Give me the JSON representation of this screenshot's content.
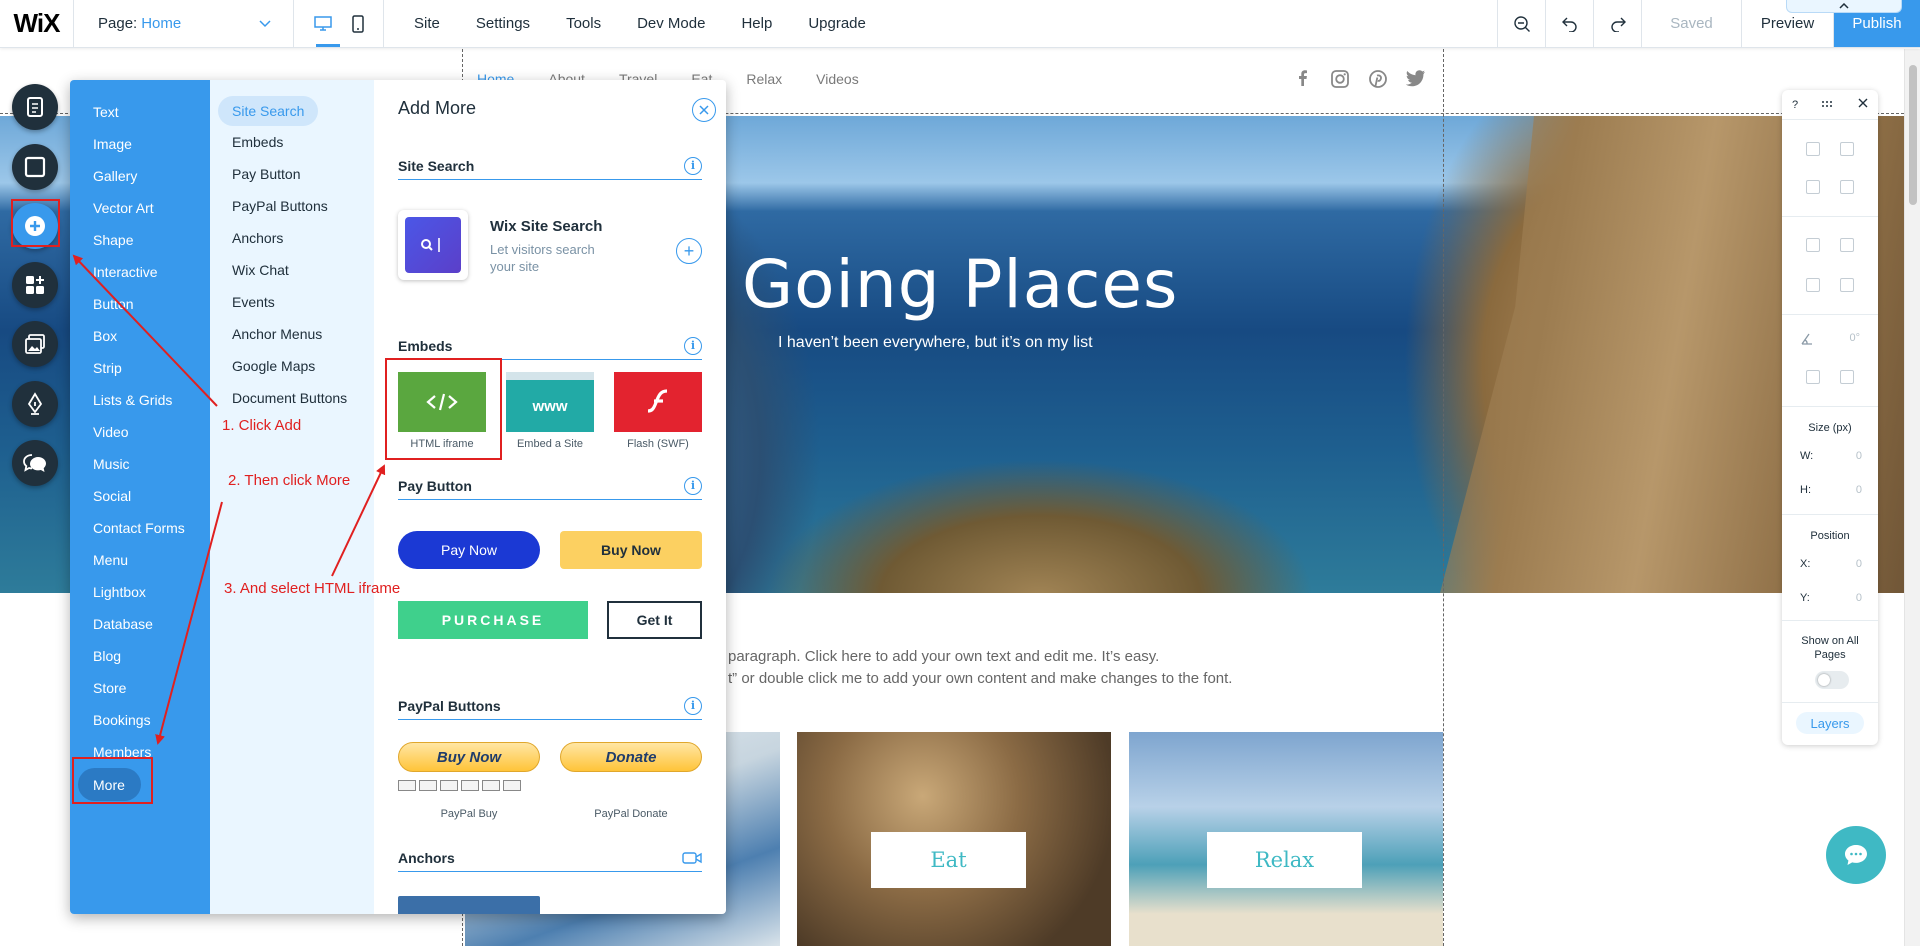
{
  "topbar": {
    "logo": "WiX",
    "page_label": "Page:",
    "page_value": "Home",
    "menu": [
      "Site",
      "Settings",
      "Tools",
      "Dev Mode",
      "Help",
      "Upgrade"
    ],
    "saved": "Saved",
    "preview": "Preview",
    "publish": "Publish",
    "accent_color": "#3899ec"
  },
  "site": {
    "nav": [
      "Home",
      "About",
      "Travel",
      "Eat",
      "Relax",
      "Videos"
    ],
    "social": [
      "facebook-icon",
      "instagram-icon",
      "pinterest-icon",
      "twitter-icon"
    ],
    "hero_title": "Going Places",
    "hero_subtitle": "I haven’t been everywhere, but it’s on my list",
    "para_line1": "paragraph. Click here to add your own text and edit me. It’s easy.",
    "para_line2": "t” or double click me to add your own content and make changes to the font.",
    "tiles": [
      "Eat",
      "Relax"
    ]
  },
  "add_panel": {
    "main_items": [
      "Text",
      "Image",
      "Gallery",
      "Vector Art",
      "Shape",
      "Interactive",
      "Button",
      "Box",
      "Strip",
      "Lists & Grids",
      "Video",
      "Music",
      "Social",
      "Contact Forms",
      "Menu",
      "Lightbox",
      "Database",
      "Blog",
      "Store",
      "Bookings",
      "Members"
    ],
    "more": "More",
    "sub_selected": "Site Search",
    "sub_items": [
      "Embeds",
      "Pay Button",
      "PayPal Buttons",
      "Anchors",
      "Wix Chat",
      "Events",
      "Anchor Menus",
      "Google Maps",
      "Document Buttons"
    ],
    "title": "Add More",
    "sections": {
      "site_search": "Site Search",
      "embeds": "Embeds",
      "pay_button": "Pay Button",
      "paypal": "PayPal Buttons",
      "anchors": "Anchors"
    },
    "search_card": {
      "title": "Wix Site Search",
      "desc": "Let visitors search your site"
    },
    "embeds": [
      {
        "label": "HTML iframe",
        "glyph": "</>",
        "color": "#5aa73f"
      },
      {
        "label": "Embed a Site",
        "glyph": "www",
        "color": "#22aaa6"
      },
      {
        "label": "Flash (SWF)",
        "glyph": "f",
        "color": "#e3232f"
      }
    ],
    "pay_buttons": {
      "pay_now": "Pay Now",
      "buy_now": "Buy Now",
      "purchase": "PURCHASE",
      "get_it": "Get It"
    },
    "paypal_buttons": {
      "buy_now": "Buy Now",
      "donate": "Donate",
      "buy_caption": "PayPal Buy",
      "donate_caption": "PayPal Donate"
    }
  },
  "annotations": {
    "step1": "1. Click Add",
    "step2": "2. Then click More",
    "step3": "3. And select HTML iframe",
    "color": "#e02020"
  },
  "tool_panel": {
    "help": "?",
    "size_label": "Size (px)",
    "w_label": "W:",
    "h_label": "H:",
    "position_label": "Position",
    "x_label": "X:",
    "y_label": "Y:",
    "value_zero": "0",
    "rotation": "0°",
    "show_all_pages": "Show on All Pages",
    "layers": "Layers"
  }
}
